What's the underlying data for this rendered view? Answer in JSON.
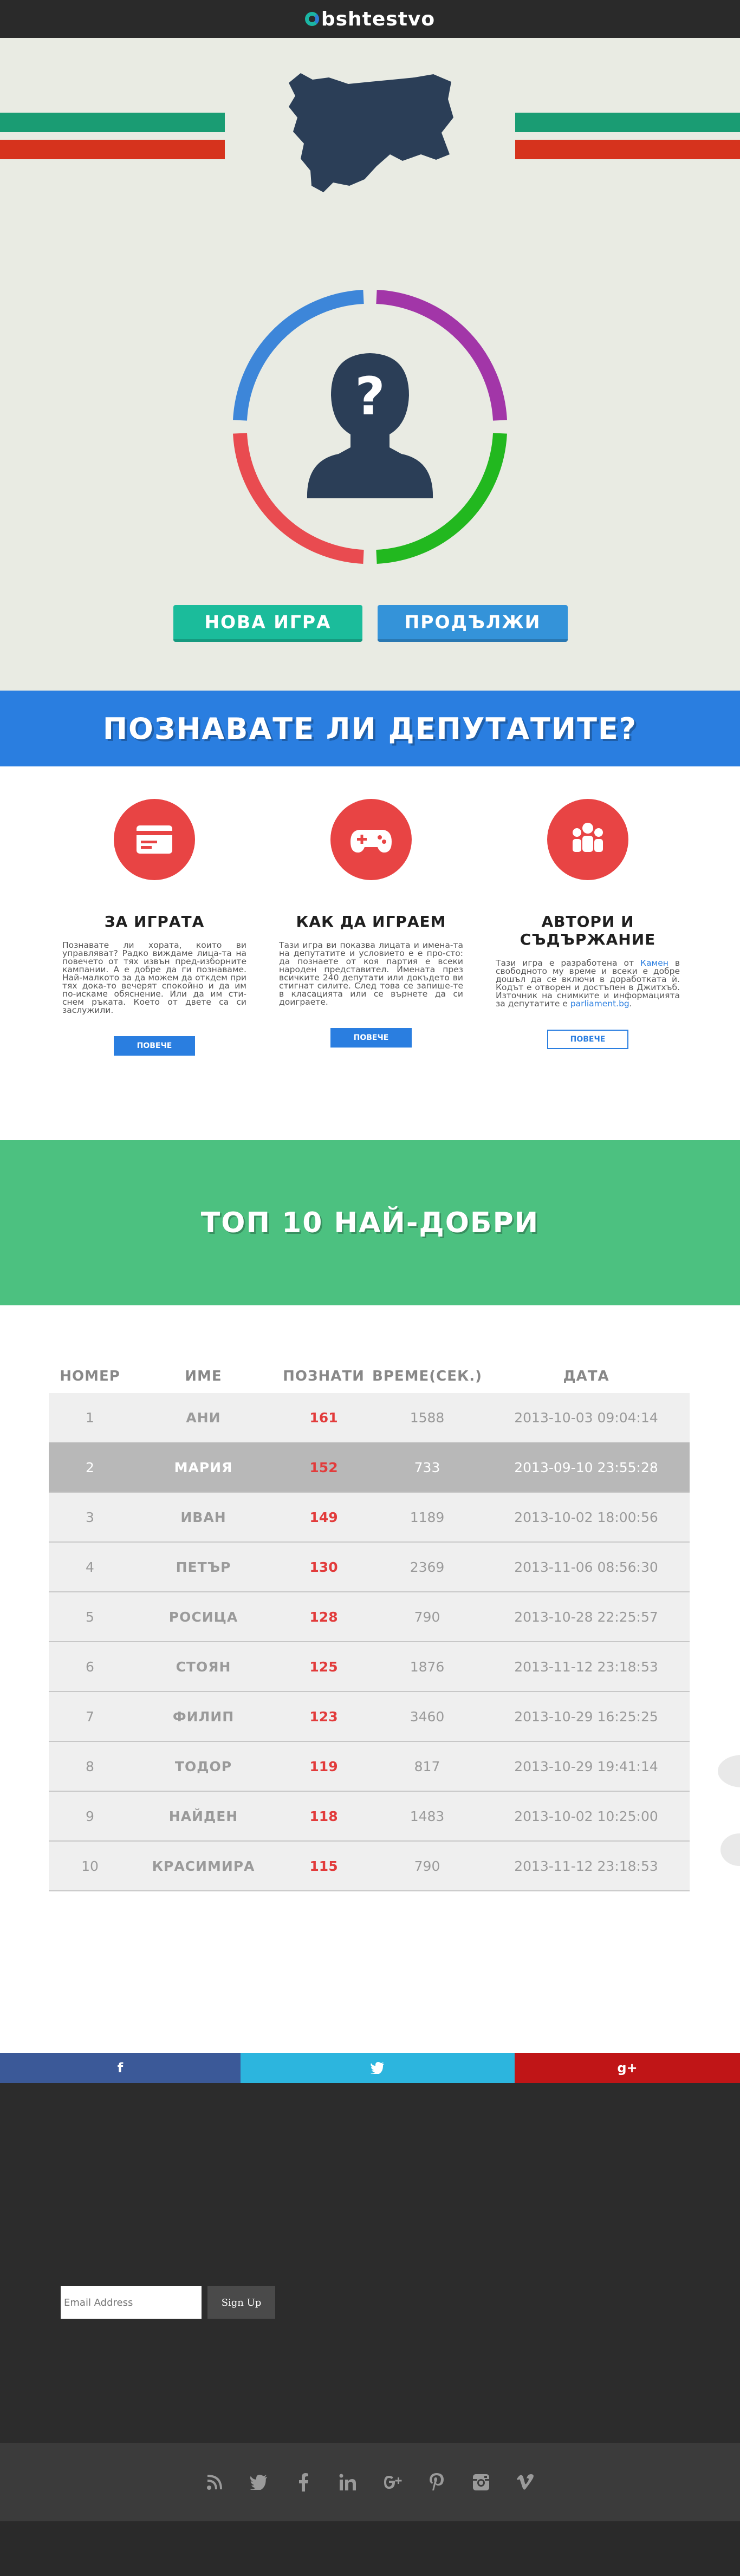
{
  "header": {
    "logo_text": "bshtestvo"
  },
  "hero": {
    "buttons": {
      "new_game": "НОВА ИГРА",
      "continue": "ПРОДЪЛЖИ"
    },
    "colors": {
      "green": "#1a9c73",
      "red": "#d6331d",
      "ring_blue": "#3d86d9",
      "ring_purple": "#a236a8",
      "ring_red": "#e94b50",
      "ring_green": "#22b81f",
      "silhouette": "#2b3e57"
    }
  },
  "banner": {
    "title": "ПОЗНАВАТЕ ЛИ ДЕПУТАТИТЕ?"
  },
  "features": [
    {
      "title": "ЗА ИГРАТА",
      "icon": "card-icon",
      "text": "Познавате ли хората, които ви управляват? Радко виждаме лица-та на повечето от тях извън пред-изборните кампании. А е добре да ги познаваме. Най-малкото за да можем да откдем при тях докa-то вечерят спокойно и да им по-искаме обяснение. Или да им сти-снем ръката. Което от двете са си заслужили.",
      "more": "ПОВЕЧЕ"
    },
    {
      "title": "КАК ДА ИГРАЕМ",
      "icon": "gamepad-icon",
      "text": "Тази игра ви показва лицата и имена-та на депутатите и условието е е про-сто: да познаете от коя партия е всеки народен представител. Имената през всичките 240 депутати или докъдето ви стигнат силите. След това се запише-те в класацията или се върнете да си доиграете.",
      "more": "ПОВЕЧЕ"
    },
    {
      "title": "АВТОРИ И СЪДЪРЖАНИЕ",
      "icon": "people-icon",
      "text_pre": "Тази игра е разработена от ",
      "link1": "Камен",
      "text_mid": " в свободното му време и всеки е добре дошъл да се включи в доработката ѝ. Кодът е отворен и достъпен в Джитхъб. Източник на снимките и информацията за депутатите е ",
      "link2": "parliament.bg",
      "text_post": ".",
      "more": "ПОВЕЧЕ"
    }
  ],
  "top10": {
    "title": "ТОП 10 НАЙ-ДОБРИ",
    "columns": [
      "НОМЕР",
      "ИМЕ",
      "ПОЗНАТИ",
      "ВРЕМЕ(СЕК.)",
      "ДАТА"
    ],
    "rows": [
      {
        "num": "1",
        "name": "АНИ",
        "score": "161",
        "time": "1588",
        "date": "2013-10-03 09:04:14"
      },
      {
        "num": "2",
        "name": "МАРИЯ",
        "score": "152",
        "time": "733",
        "date": "2013-09-10 23:55:28",
        "selected": true
      },
      {
        "num": "3",
        "name": "ИВАН",
        "score": "149",
        "time": "1189",
        "date": "2013-10-02 18:00:56"
      },
      {
        "num": "4",
        "name": "ПЕТЪР",
        "score": "130",
        "time": "2369",
        "date": "2013-11-06 08:56:30"
      },
      {
        "num": "5",
        "name": "РОСИЦА",
        "score": "128",
        "time": "790",
        "date": "2013-10-28 22:25:57"
      },
      {
        "num": "6",
        "name": "СТОЯН",
        "score": "125",
        "time": "1876",
        "date": "2013-11-12 23:18:53"
      },
      {
        "num": "7",
        "name": "ФИЛИП",
        "score": "123",
        "time": "3460",
        "date": "2013-10-29 16:25:25"
      },
      {
        "num": "8",
        "name": "ТОДОР",
        "score": "119",
        "time": "817",
        "date": "2013-10-29 19:41:14"
      },
      {
        "num": "9",
        "name": "НАЙДЕН",
        "score": "118",
        "time": "1483",
        "date": "2013-10-02 10:25:00"
      },
      {
        "num": "10",
        "name": "КРАСИМИРА",
        "score": "115",
        "time": "790",
        "date": "2013-11-12 23:18:53"
      }
    ]
  },
  "social_share": {
    "facebook": "f",
    "twitter": "twitter-icon",
    "google_plus": "g+",
    "colors": {
      "facebook": "#3b5998",
      "twitter": "#2cb5de",
      "google_plus": "#c01517"
    }
  },
  "newsletter": {
    "placeholder": "Email Address",
    "button": "Sign Up"
  },
  "footer_icons": [
    "rss-icon",
    "twitter-icon",
    "facebook-icon",
    "linkedin-icon",
    "google-plus-icon",
    "pinterest-icon",
    "instagram-icon",
    "vimeo-icon"
  ]
}
